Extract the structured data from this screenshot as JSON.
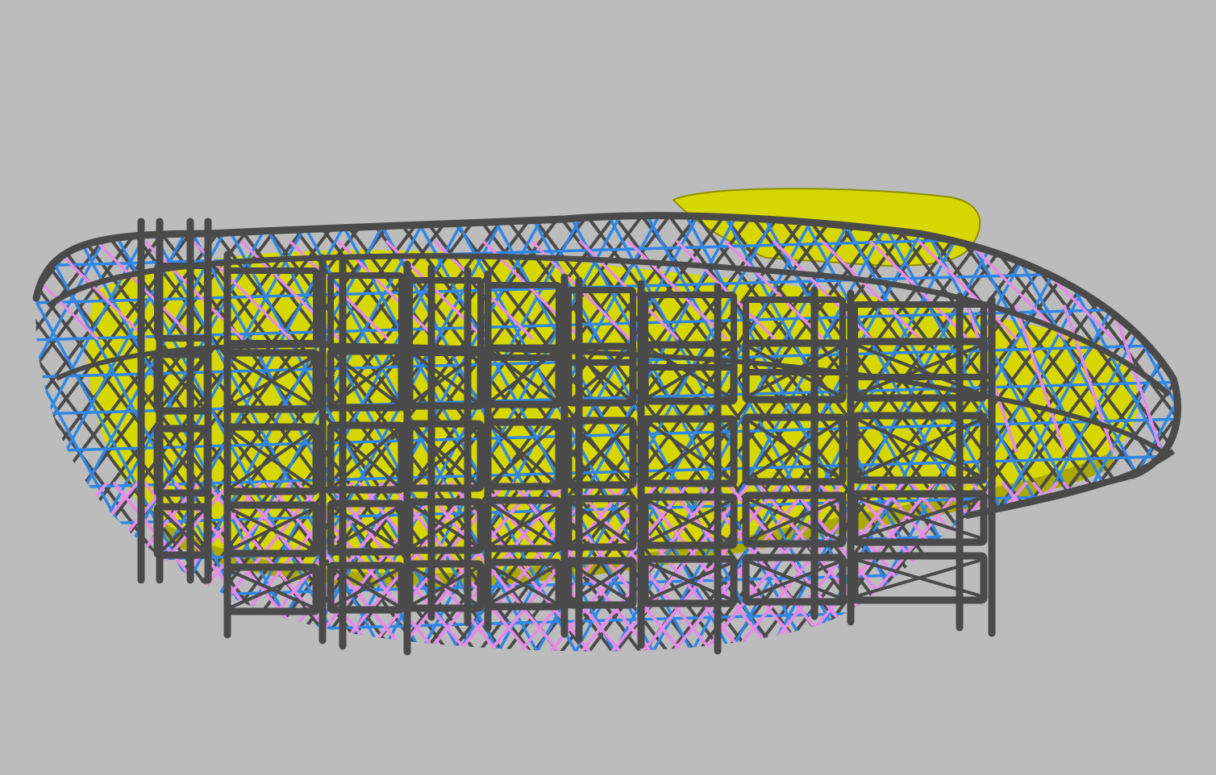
{
  "viewport": {
    "background": "#bcbcbc"
  },
  "model": {
    "core_color": "#d6d600",
    "core_shadow": "#a9a900",
    "rod_dark": "#4a4a4a",
    "rod_blue": "#2f86e6",
    "rod_pink": "#e58be6"
  }
}
